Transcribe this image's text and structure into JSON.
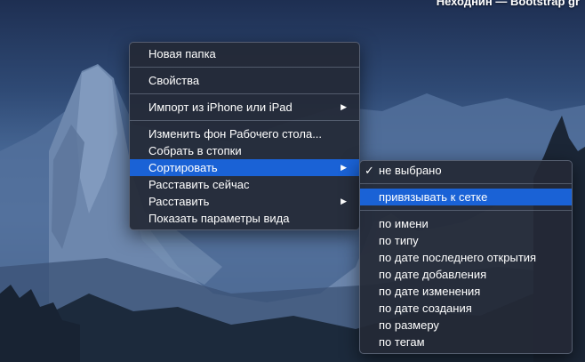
{
  "header": {
    "partial_text": "Неходнин — Bootstrap gr"
  },
  "context_menu": {
    "items": [
      {
        "label": "Новая папка"
      },
      {
        "label": "Свойства"
      },
      {
        "label": "Импорт из iPhone или iPad"
      },
      {
        "label": "Изменить фон Рабочего стола..."
      },
      {
        "label": "Собрать в стопки"
      },
      {
        "label": "Сортировать"
      },
      {
        "label": "Расставить сейчас"
      },
      {
        "label": "Расставить"
      },
      {
        "label": "Показать параметры вида"
      }
    ],
    "arrow_glyph": "▶"
  },
  "sort_submenu": {
    "checkmark": "✓",
    "items": [
      {
        "label": "не выбрано",
        "checked": true
      },
      {
        "label": "привязывать к сетке"
      },
      {
        "label": "по имени"
      },
      {
        "label": "по типу"
      },
      {
        "label": "по дате последнего открытия"
      },
      {
        "label": "по дате добавления"
      },
      {
        "label": "по дате изменения"
      },
      {
        "label": "по дате создания"
      },
      {
        "label": "по размеру"
      },
      {
        "label": "по тегам"
      }
    ]
  },
  "colors": {
    "highlight": "#1a62d6",
    "menu_bg": "#242936"
  }
}
